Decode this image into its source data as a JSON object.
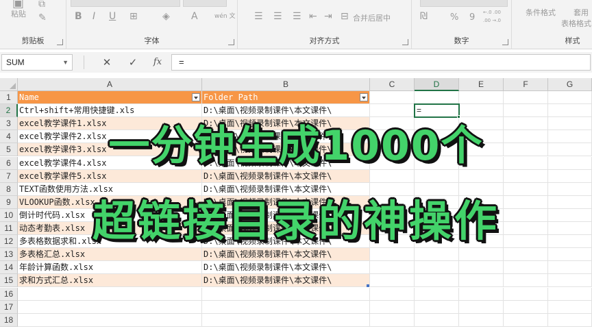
{
  "ribbon": {
    "clipboard": {
      "label": "剪贴板",
      "paste_label": "粘贴"
    },
    "font": {
      "label": "字体",
      "bold": "B",
      "italic": "I",
      "underline": "U",
      "font_color": "A",
      "phonetic": "wén 文"
    },
    "alignment": {
      "label": "对齐方式",
      "merge_center": "合并后居中"
    },
    "number": {
      "label": "数字",
      "percent": "%",
      "comma": "9",
      "inc_decimal": "←.0 .00",
      "dec_decimal": ".00 →.0"
    },
    "styles": {
      "label": "样式",
      "conditional_format": "条件格式",
      "table_format_top": "套用",
      "table_format_bottom": "表格格式"
    }
  },
  "formula_bar": {
    "name_box": "SUM",
    "cancel": "✕",
    "enter": "✓",
    "fx": "fx",
    "formula": "="
  },
  "columns": [
    "A",
    "B",
    "C",
    "D",
    "E",
    "F",
    "G"
  ],
  "active_column": "D",
  "active_row": 2,
  "rows": [
    {
      "n": "1",
      "a": "Name",
      "b": "Folder Path"
    },
    {
      "n": "2",
      "a": "Ctrl+shift+常用快捷键.xls",
      "b": "D:\\桌面\\视频录制课件\\本文课件\\"
    },
    {
      "n": "3",
      "a": "excel教学课件1.xlsx",
      "b": "D:\\桌面\\视频录制课件\\本文课件\\"
    },
    {
      "n": "4",
      "a": "excel教学课件2.xlsx",
      "b": "D:\\桌面\\视频录制课件\\本文课件\\"
    },
    {
      "n": "5",
      "a": "excel教学课件3.xlsx",
      "b": "D:\\桌面\\视频录制课件\\本文课件\\"
    },
    {
      "n": "6",
      "a": "excel教学课件4.xlsx",
      "b": "D:\\桌面\\视频录制课件\\本文课件\\"
    },
    {
      "n": "7",
      "a": "excel教学课件5.xlsx",
      "b": "D:\\桌面\\视频录制课件\\本文课件\\"
    },
    {
      "n": "8",
      "a": "TEXT函数使用方法.xlsx",
      "b": "D:\\桌面\\视频录制课件\\本文课件\\"
    },
    {
      "n": "9",
      "a": "VLOOKUP函数.xlsx",
      "b": "D:\\桌面\\视频录制课件\\本文课件\\"
    },
    {
      "n": "10",
      "a": "倒计时代码.xlsx",
      "b": "D:\\桌面\\视频录制课件\\本文课件\\"
    },
    {
      "n": "11",
      "a": "动态考勤表.xlsx",
      "b": "D:\\桌面\\视频录制课件\\本文课件\\"
    },
    {
      "n": "12",
      "a": "多表格数据求和.xlsx",
      "b": "D:\\桌面\\视频录制课件\\本文课件\\"
    },
    {
      "n": "13",
      "a": "多表格汇总.xlsx",
      "b": "D:\\桌面\\视频录制课件\\本文课件\\"
    },
    {
      "n": "14",
      "a": "年龄计算函数.xlsx",
      "b": "D:\\桌面\\视频录制课件\\本文课件\\"
    },
    {
      "n": "15",
      "a": "求和方式汇总.xlsx",
      "b": "D:\\桌面\\视频录制课件\\本文课件\\"
    },
    {
      "n": "16",
      "a": "",
      "b": ""
    },
    {
      "n": "17",
      "a": "",
      "b": ""
    },
    {
      "n": "18",
      "a": "",
      "b": ""
    }
  ],
  "active_cell_value": "=",
  "caption": {
    "line1": "一分钟生成1000个",
    "line2": "超链接目录的神操作"
  },
  "colors": {
    "header_fill": "#f79646",
    "band_fill": "#fde9d9",
    "accent": "#217346",
    "caption_text": "#43d36a",
    "caption_outline": "#111111"
  }
}
